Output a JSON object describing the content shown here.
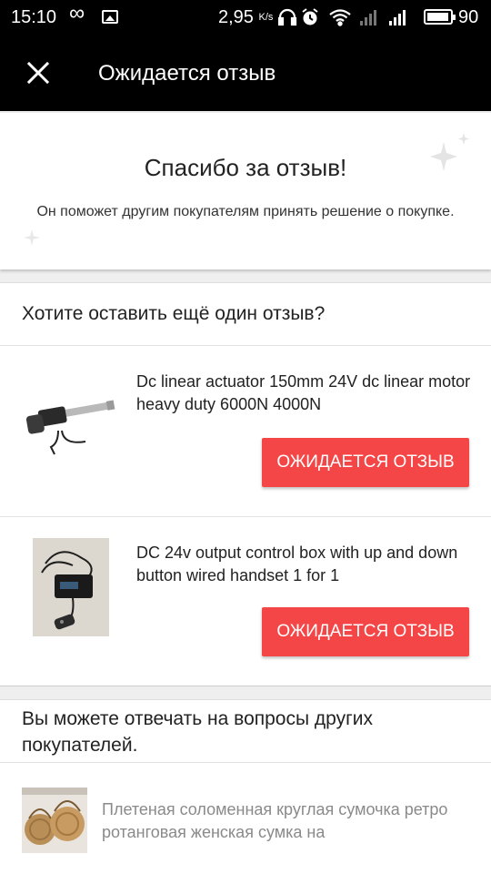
{
  "status_bar": {
    "time": "15:10",
    "infinity": "∞",
    "speed": "2,95",
    "speed_unit": "K/s",
    "battery": "90"
  },
  "header": {
    "title": "Ожидается отзыв",
    "close_icon": "close-icon"
  },
  "thanks": {
    "title": "Спасибо за отзыв!",
    "subtitle": "Он поможет другим покупателям принять решение о покупке."
  },
  "another_review": {
    "heading": "Хотите оставить ещё один отзыв?",
    "products": [
      {
        "title": "Dc linear actuator 150mm 24V dc linear motor heavy duty 6000N 4000N",
        "button_label": "ОЖИДАЕТСЯ ОТЗЫВ",
        "image": "linear-actuator-image"
      },
      {
        "title": "DC 24v output control box with up and down button wired handset  1 for 1",
        "button_label": "ОЖИДАЕТСЯ ОТЗЫВ",
        "image": "control-box-image"
      }
    ]
  },
  "questions": {
    "heading": "Вы можете отвечать на вопросы других покупателей.",
    "items": [
      {
        "title": "Плетеная соломенная круглая сумочка ретро ротанговая женская сумка на",
        "image": "straw-bag-image"
      }
    ]
  },
  "colors": {
    "accent": "#f44646",
    "header_bg": "#000000",
    "page_bg": "#efefef"
  }
}
